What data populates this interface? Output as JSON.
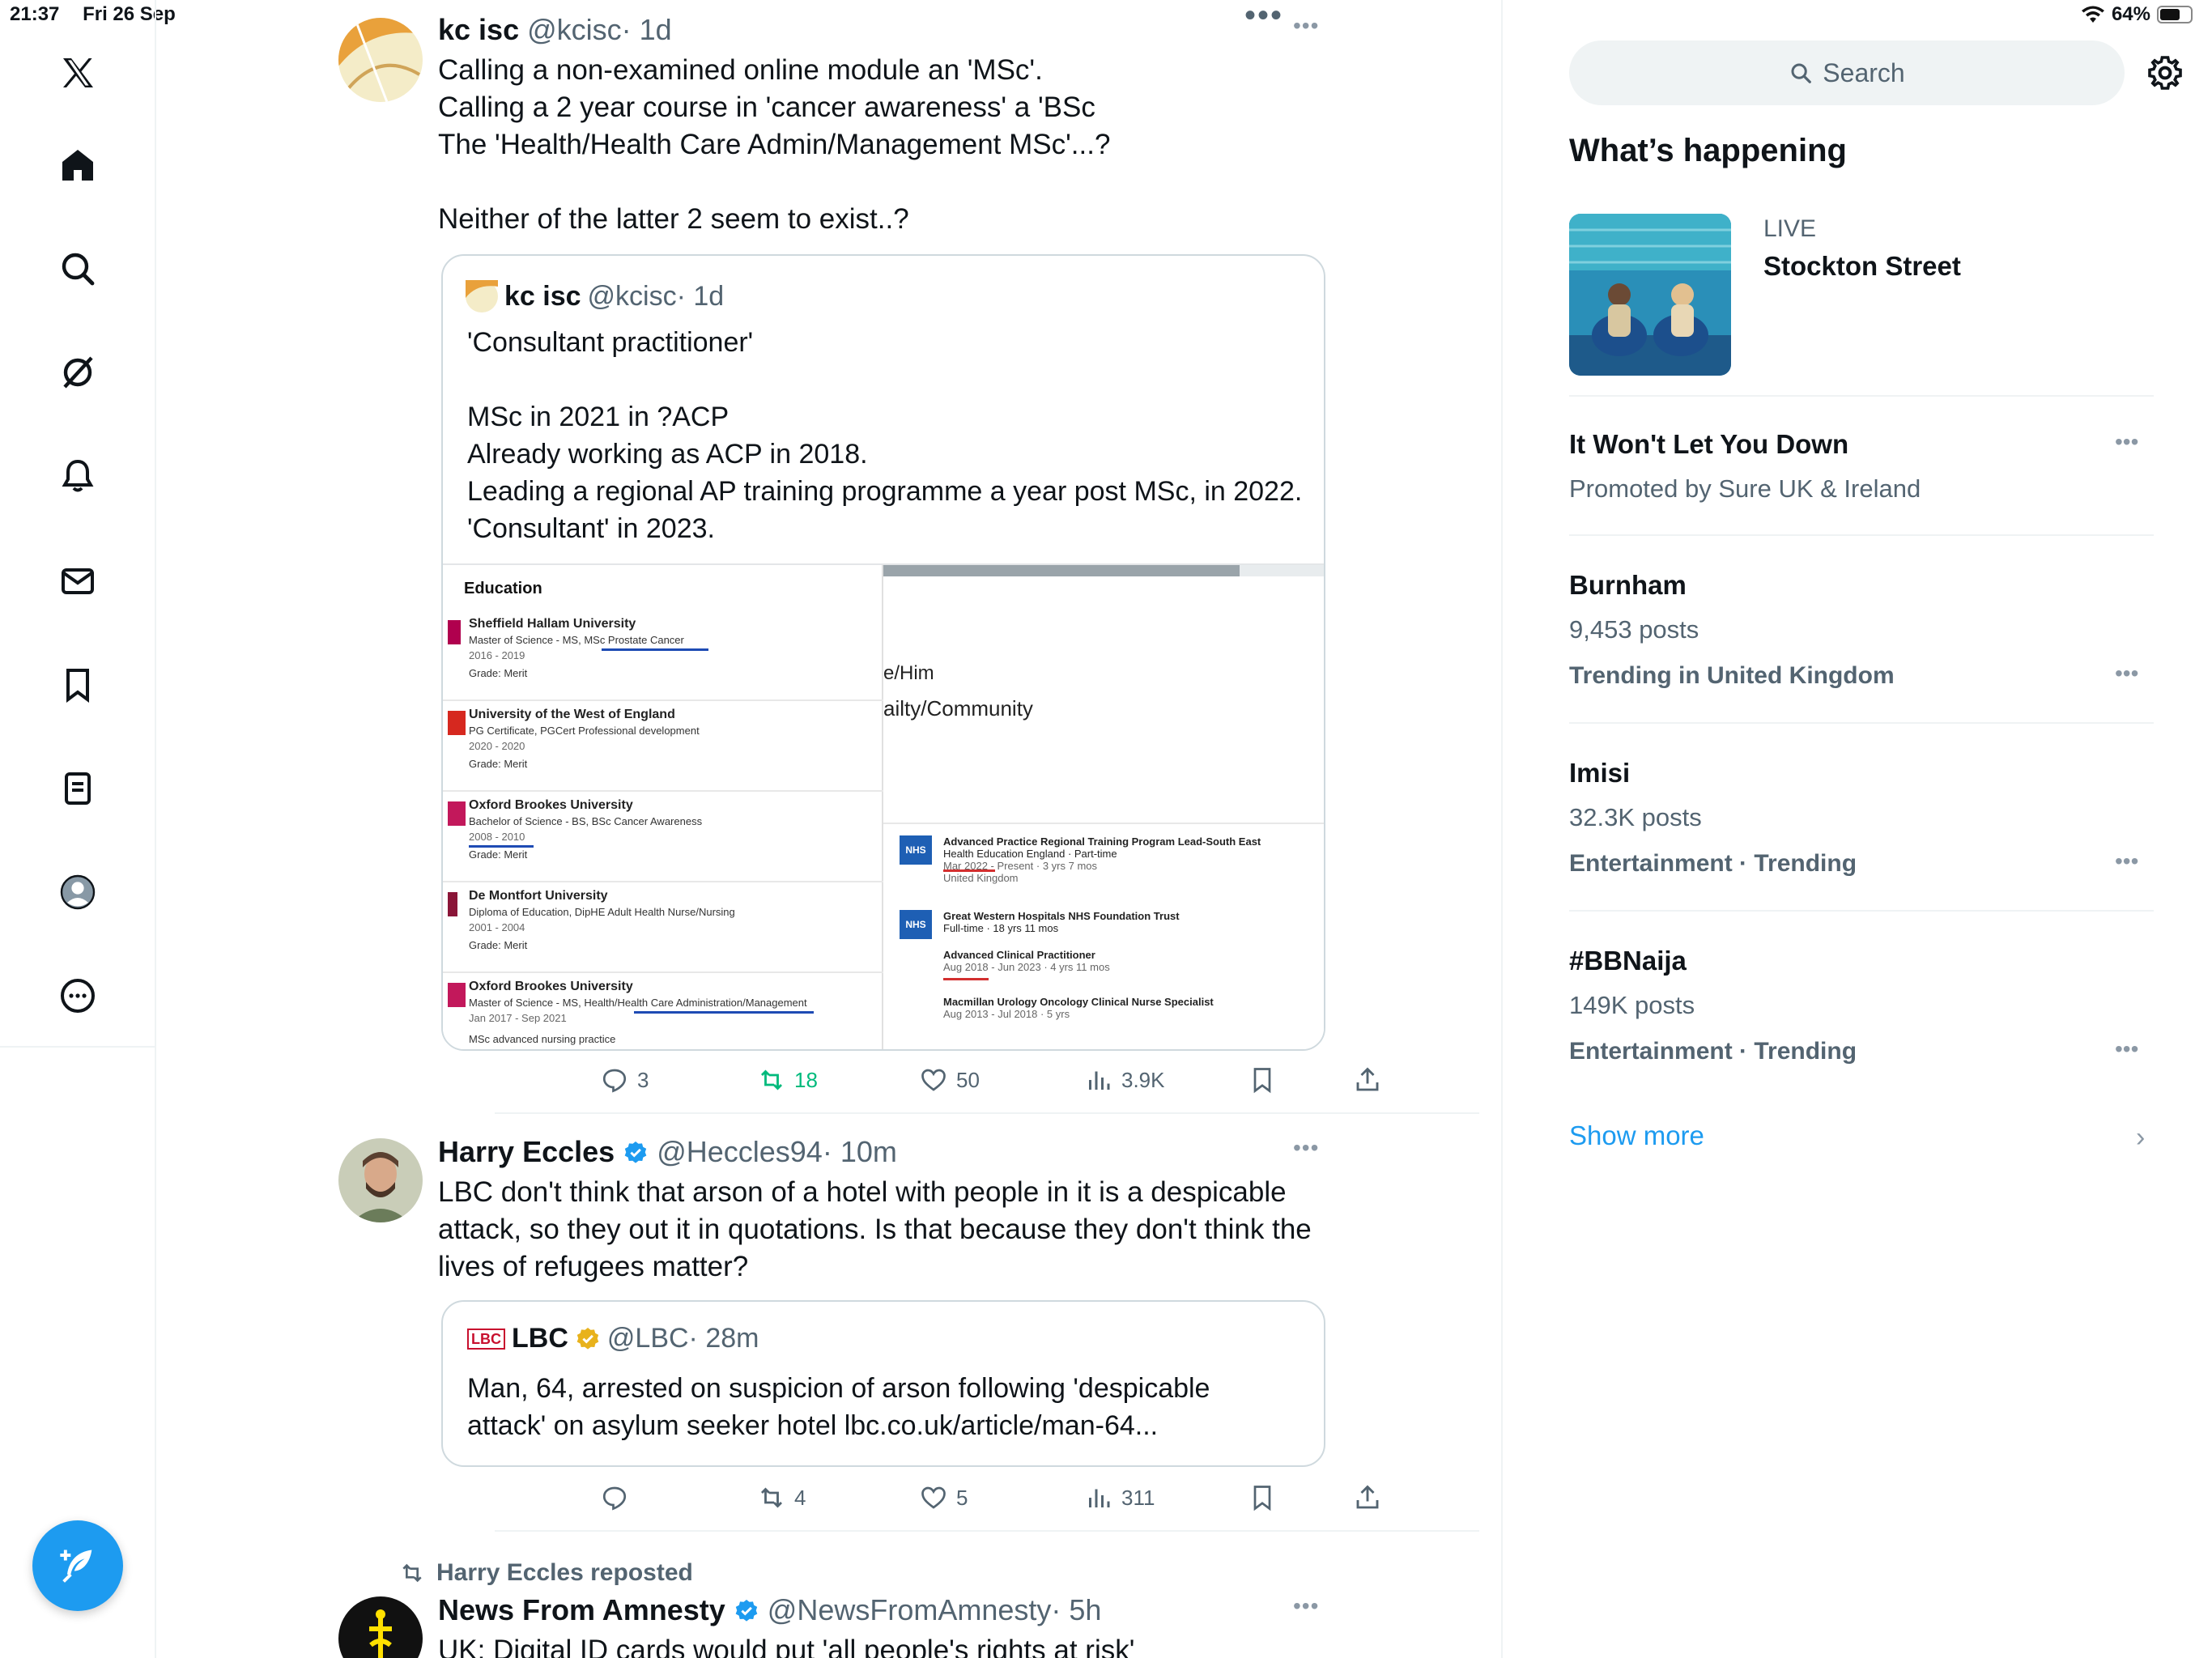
{
  "status_bar": {
    "time": "21:37",
    "date": "Fri 26 Sep",
    "battery": "64%",
    "battery_level": 0.64
  },
  "nav": {
    "items": [
      "home",
      "explore",
      "grok",
      "notifications",
      "messages",
      "bookmarks",
      "lists",
      "profile",
      "more"
    ],
    "compose_label": "Post"
  },
  "feed": {
    "tweets": [
      {
        "name": "kc isc",
        "handle": "@kcisc",
        "time": "· 1d",
        "lines": [
          "Calling a non-examined online module an 'MSc'.",
          "Calling a 2 year course in 'cancer awareness' a 'BSc",
          "The 'Health/Health Care Admin/Management MSc'...?",
          "",
          "Neither of the latter 2 seem to exist..?"
        ],
        "quote": {
          "name": "kc isc",
          "handle": "@kcisc",
          "time": "· 1d",
          "lines": [
            "'Consultant practitioner'",
            "",
            "MSc in 2021 in ?ACP",
            "Already working as ACP in 2018.",
            "Leading a regional AP training programme a year post MSc, in 2022.",
            "'Consultant' in 2023."
          ],
          "image": {
            "title": "Education",
            "entries": [
              {
                "school": "Sheffield Hallam University",
                "degree": "Master of Science - MS, MSc Prostate Cancer",
                "years": "2016 - 2019",
                "grade": "Grade: Merit"
              },
              {
                "school": "University of the West of England",
                "degree": "PG Certificate, PGCert Professional development",
                "years": "2020 - 2020",
                "grade": "Grade: Merit"
              },
              {
                "school": "Oxford Brookes University",
                "degree": "Bachelor of Science - BS, BSc Cancer Awareness",
                "years": "2008 - 2010",
                "grade": "Grade: Merit"
              },
              {
                "school": "De Montfort University",
                "degree": "Diploma of Education, DipHE Adult Health Nurse/Nursing",
                "years": "2001 - 2004",
                "grade": "Grade: Merit"
              },
              {
                "school": "Oxford Brookes University",
                "degree": "Master of Science - MS, Health/Health Care Administration/Management",
                "years": "Jan 2017 - Sep 2021",
                "grade": "MSc advanced nursing practice"
              }
            ],
            "right_text_1": "e/Him",
            "right_text_2": "ailty/Community",
            "jobs": [
              {
                "title": "Advanced Practice Regional Training Program Lead-South East",
                "org": "Health Education England · Part-time",
                "dates": "Mar 2022 - Present · 3 yrs 7 mos",
                "place": "United Kingdom"
              },
              {
                "title": "Great Western Hospitals NHS Foundation Trust",
                "org": "Full-time · 18 yrs 11 mos",
                "dates": "",
                "place": ""
              },
              {
                "title": "Advanced Clinical Practitioner",
                "org": "",
                "dates": "Aug 2018 - Jun 2023 · 4 yrs 11 mos",
                "place": ""
              },
              {
                "title": "Macmillan Urology Oncology Clinical Nurse Specialist",
                "org": "",
                "dates": "Aug 2013 - Jul 2018 · 5 yrs",
                "place": ""
              }
            ],
            "nhs_label": "NHS"
          }
        },
        "stats": {
          "replies": "3",
          "reposts": "18",
          "likes": "50",
          "views": "3.9K"
        }
      },
      {
        "name": "Harry Eccles",
        "handle": "@Heccles94",
        "time": "· 10m",
        "lines": [
          "LBC don't think that arson of a hotel with people in it is a despicable",
          "attack, so they out it in quotations. Is that because they don't think the",
          "lives of refugees matter?"
        ],
        "quote": {
          "name": "LBC",
          "handle": "@LBC",
          "time": "· 28m",
          "logo": "LBC",
          "lines": [
            "Man, 64, arrested on suspicion of arson following 'despicable",
            "attack' on asylum seeker hotel lbc.co.uk/article/man-64..."
          ]
        },
        "stats": {
          "replies": "",
          "reposts": "4",
          "likes": "5",
          "views": "311"
        }
      },
      {
        "repost_label": "Harry Eccles reposted",
        "name": "News From Amnesty",
        "handle": "@NewsFromAmnesty",
        "time": "· 5h",
        "lines": [
          "UK: Digital ID cards would put 'all people's rights at risk'"
        ]
      }
    ]
  },
  "sidebar": {
    "search_placeholder": "Search",
    "heading": "What’s happening",
    "live": {
      "label": "LIVE",
      "title": "Stockton Street"
    },
    "trends": [
      {
        "title": "It Won't Let You Down",
        "sub": "Promoted by Sure UK & Ireland",
        "meta": ""
      },
      {
        "title": "Burnham",
        "sub": "9,453 posts",
        "meta": "Trending in United Kingdom"
      },
      {
        "title": "Imisi",
        "sub": "32.3K posts",
        "meta": "Entertainment · Trending"
      },
      {
        "title": "#BBNaija",
        "sub": "149K posts",
        "meta": "Entertainment · Trending"
      }
    ],
    "show_more": "Show more"
  },
  "colors": {
    "accent": "#1d9bf0",
    "repost_green": "#00ba7c",
    "verified_gold": "#e8b21c"
  }
}
